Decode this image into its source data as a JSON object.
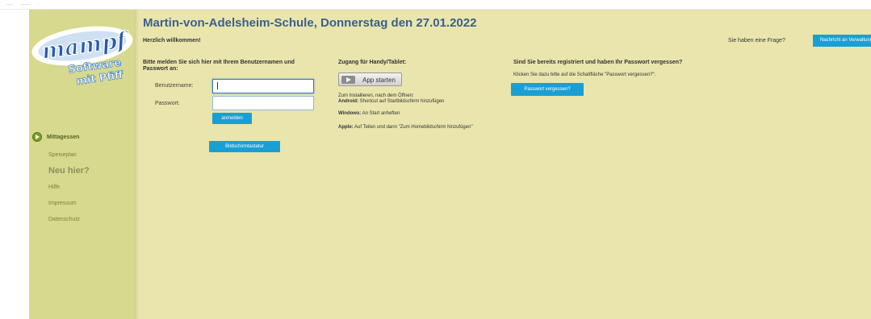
{
  "sidebar": {
    "logo_text": "mampf",
    "logo_tagline_1": "Software",
    "logo_tagline_2": "mit Pfiff",
    "items": [
      {
        "label": "Mittagessen",
        "active": true
      },
      {
        "label": "Speiseplan"
      },
      {
        "label": "Neu hier?"
      },
      {
        "label": "Hilfe"
      },
      {
        "label": "Impressum"
      },
      {
        "label": "Datenschutz"
      }
    ]
  },
  "header": {
    "title": "Martin-von-Adelsheim-Schule, Donnerstag den 27.01.2022",
    "welcome": "Herzlich willkommen!",
    "question": "Sie haben eine Frage?",
    "message_button": "Nachricht an Verwaltung"
  },
  "login": {
    "heading_1": "Bitte melden Sie sich hier mit Ihrem Benutzernamen und",
    "heading_2": "Passwort an:",
    "username_label": "Benutzername:",
    "username_value": "",
    "password_label": "Passwort:",
    "password_value": "",
    "submit": "anmelden",
    "keyboard_button": "Bildschirmtastatur"
  },
  "mobile": {
    "heading": "Zugang für Handy/Tablet:",
    "app_button": "App starten",
    "install_intro": "Zum Installieren, nach dem Öffnen:",
    "android_label": "Android:",
    "android_text": " Shortcut auf Startbildschirm hinzufügen",
    "windows_label": "Windows:",
    "windows_text": " An Start anheften",
    "apple_label": "Apple:",
    "apple_text": " Auf Teilen und dann \"Zum Homebildschirm hinzufügen\""
  },
  "forgot": {
    "heading": "Sind Sie bereits registriert und haben Ihr Passwort vergessen?",
    "text": "Klicken Sie dazu bitte auf die Schaltfläche \"Passwort vergessen?\".",
    "button": "Passwort vergessen?"
  },
  "colors": {
    "sidebar": "#d6d98e",
    "main": "#e9e5ad",
    "accent": "#1a9fd5",
    "title": "#3c5f8a"
  }
}
